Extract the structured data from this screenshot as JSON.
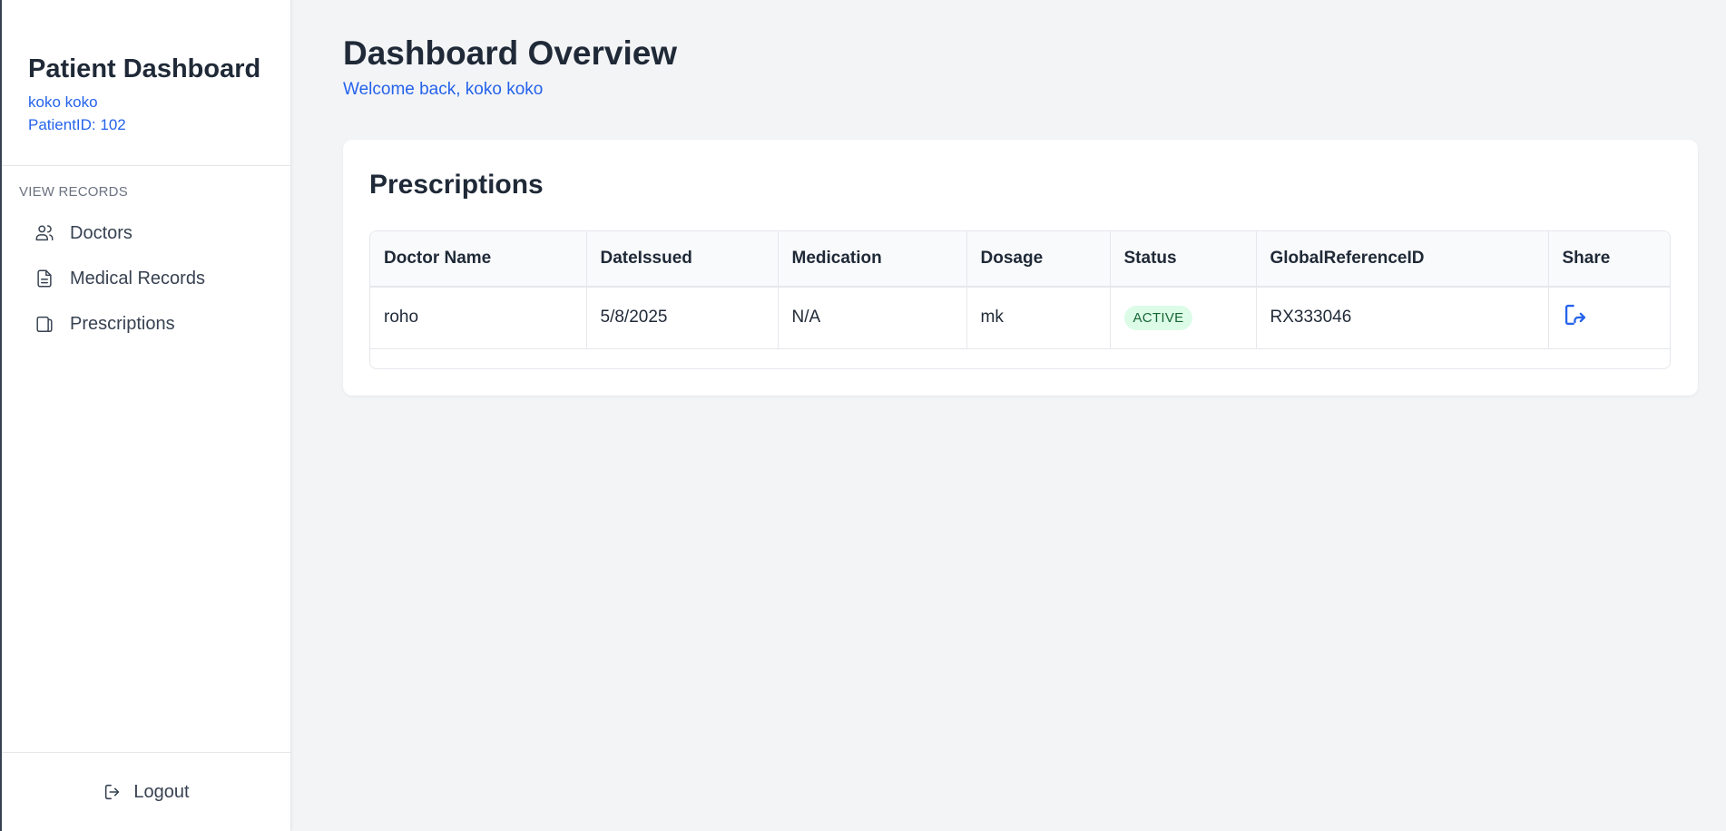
{
  "sidebar": {
    "title": "Patient Dashboard",
    "user_name": "koko koko",
    "patient_id": "PatientID: 102",
    "section_heading": "VIEW RECORDS",
    "items": [
      {
        "label": "Doctors",
        "icon": "users-icon"
      },
      {
        "label": "Medical Records",
        "icon": "document-icon"
      },
      {
        "label": "Prescriptions",
        "icon": "prescription-icon"
      }
    ],
    "logout_label": "Logout"
  },
  "header": {
    "title": "Dashboard Overview",
    "welcome": "Welcome back, koko koko"
  },
  "prescriptions": {
    "title": "Prescriptions",
    "columns": [
      "Doctor Name",
      "DateIssued",
      "Medication",
      "Dosage",
      "Status",
      "GlobalReferenceID",
      "Share"
    ],
    "rows": [
      {
        "doctor_name": "roho",
        "date_issued": "5/8/2025",
        "medication": "N/A",
        "dosage": "mk",
        "status": "ACTIVE",
        "global_reference_id": "RX333046",
        "share_icon": "share-icon"
      }
    ]
  },
  "colors": {
    "accent": "#2563eb",
    "status_active_bg": "#dcfce7",
    "status_active_text": "#166534"
  }
}
